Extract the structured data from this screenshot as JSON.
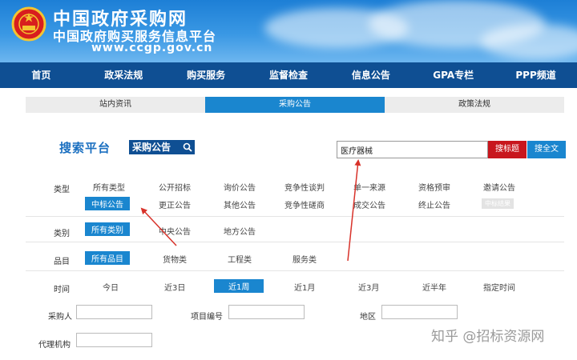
{
  "header": {
    "title": "中国政府采购网",
    "subtitle": "中国政府购买服务信息平台",
    "url": "www.ccgp.gov.cn"
  },
  "nav": {
    "items": [
      "首页",
      "政采法规",
      "购买服务",
      "监督检查",
      "信息公告",
      "GPA专栏",
      "PPP频道"
    ]
  },
  "subtabs": {
    "items": [
      "站内资讯",
      "采购公告",
      "政策法规"
    ],
    "active_index": 1
  },
  "search": {
    "title": "搜索平台",
    "badge": "采购公告",
    "query": "医疗器械",
    "btn_title": "搜标题",
    "btn_full": "搜全文"
  },
  "filters": {
    "type": {
      "label": "类型",
      "row1": [
        "所有类型",
        "公开招标",
        "询价公告",
        "竞争性谈判",
        "单一来源",
        "资格预审",
        "邀请公告"
      ],
      "row2": [
        "中标公告",
        "更正公告",
        "其他公告",
        "竞争性磋商",
        "成交公告",
        "终止公告",
        "中标结果"
      ]
    },
    "category": {
      "label": "类别",
      "options": [
        "所有类别",
        "中央公告",
        "地方公告"
      ]
    },
    "item": {
      "label": "品目",
      "options": [
        "所有品目",
        "货物类",
        "工程类",
        "服务类"
      ]
    },
    "time": {
      "label": "时间",
      "options": [
        "今日",
        "近3日",
        "近1周",
        "近1月",
        "近3月",
        "近半年",
        "指定时间"
      ]
    }
  },
  "form": {
    "buyer_label": "采购人",
    "project_label": "项目编号",
    "region_label": "地区",
    "agency_label": "代理机构"
  },
  "watermark": "知乎 @招标资源网",
  "colors": {
    "nav_bg": "#0f4f93",
    "accent": "#1a86cf",
    "danger": "#c8161d",
    "annotation": "#d8322a"
  }
}
